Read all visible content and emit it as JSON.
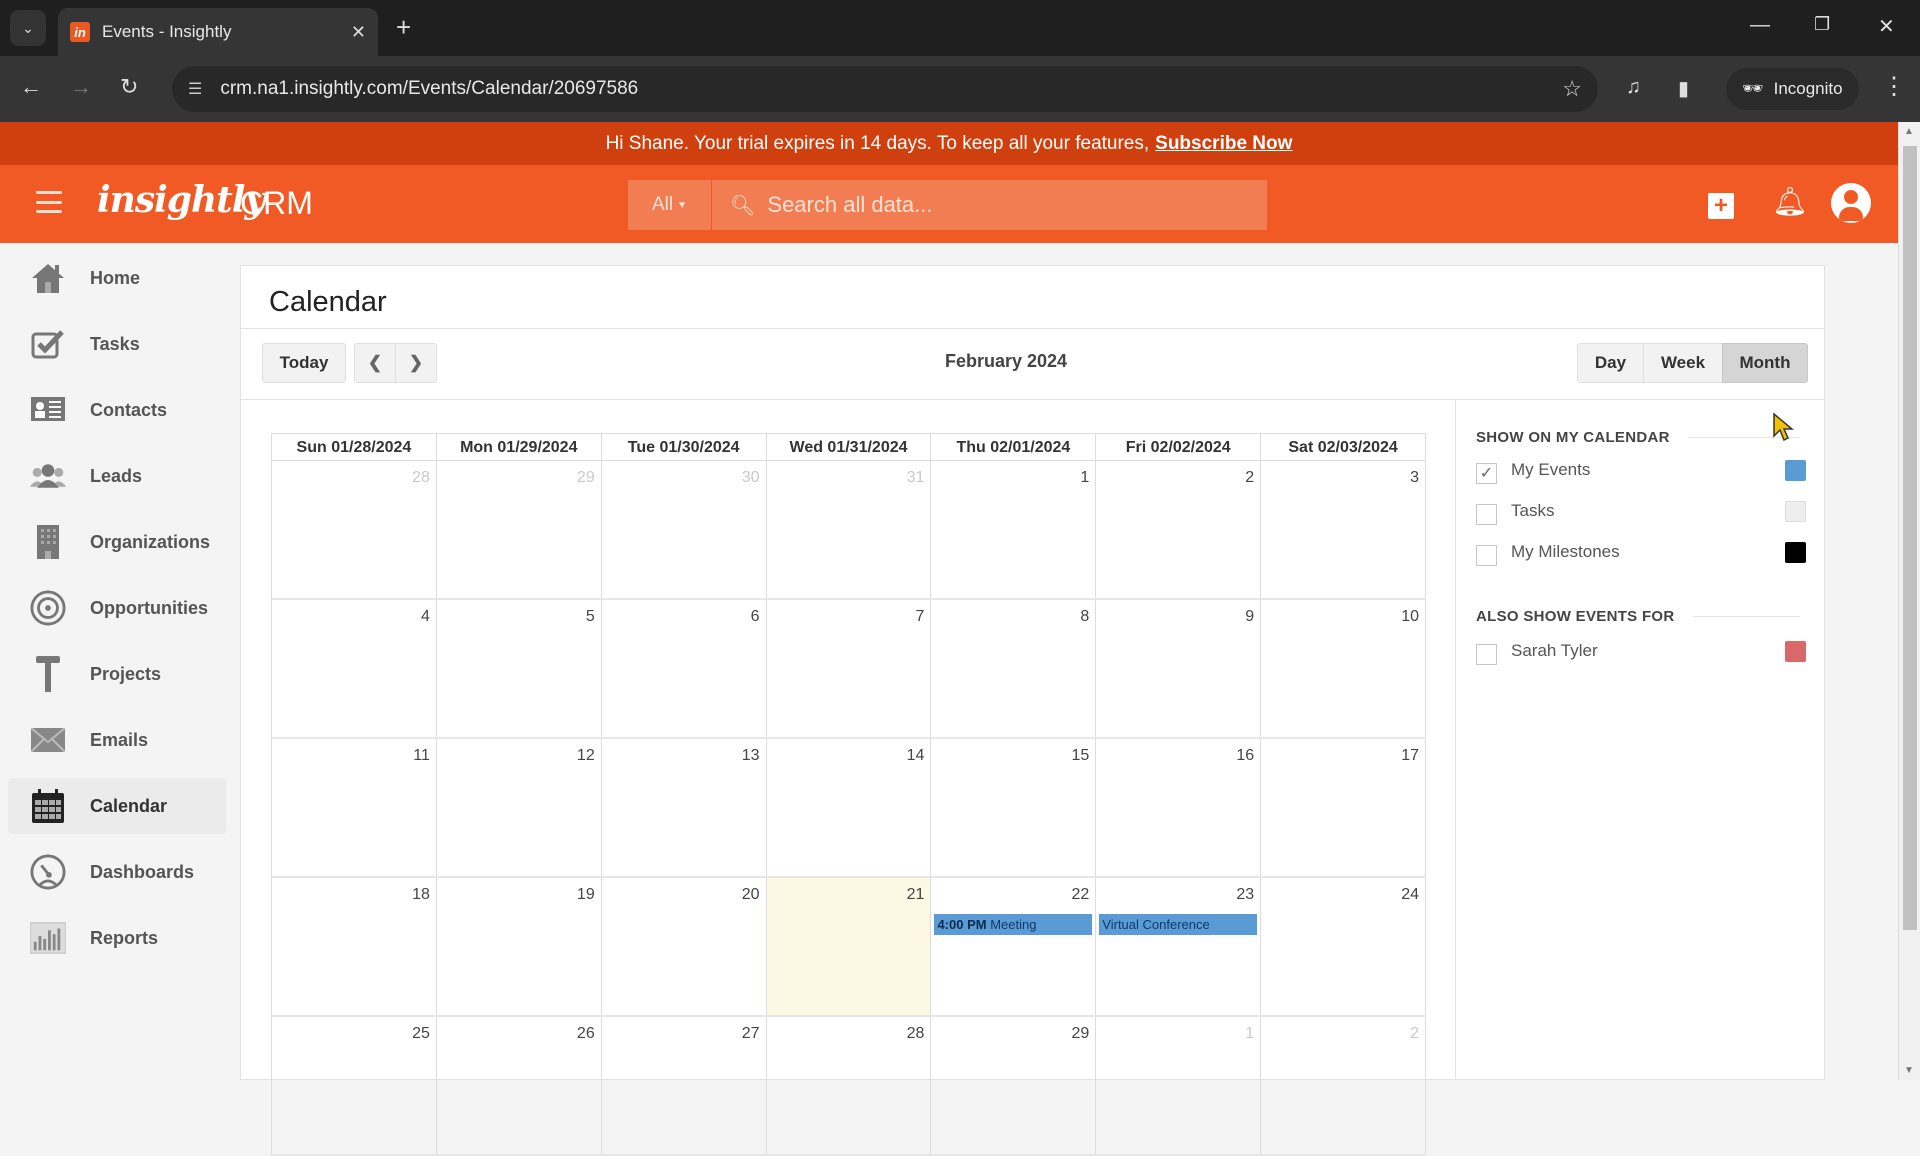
{
  "browser": {
    "tab_title": "Events - Insightly",
    "url": "crm.na1.insightly.com/Events/Calendar/20697586",
    "incognito_label": "Incognito"
  },
  "banner": {
    "message": "Hi Shane. Your trial expires in 14 days. To keep all your features,",
    "link": "Subscribe Now"
  },
  "header": {
    "logo": "insightly",
    "product": "CRM",
    "search_scope": "All",
    "search_placeholder": "Search all data..."
  },
  "sidebar": {
    "items": [
      {
        "label": "Home",
        "icon": "home-icon"
      },
      {
        "label": "Tasks",
        "icon": "tasks-icon"
      },
      {
        "label": "Contacts",
        "icon": "contacts-icon"
      },
      {
        "label": "Leads",
        "icon": "leads-icon"
      },
      {
        "label": "Organizations",
        "icon": "organizations-icon"
      },
      {
        "label": "Opportunities",
        "icon": "opportunities-icon"
      },
      {
        "label": "Projects",
        "icon": "projects-icon"
      },
      {
        "label": "Emails",
        "icon": "emails-icon"
      },
      {
        "label": "Calendar",
        "icon": "calendar-icon",
        "active": true
      },
      {
        "label": "Dashboards",
        "icon": "dashboards-icon"
      },
      {
        "label": "Reports",
        "icon": "reports-icon"
      }
    ]
  },
  "calendar": {
    "title": "Calendar",
    "today_label": "Today",
    "month_title": "February 2024",
    "views": {
      "day": "Day",
      "week": "Week",
      "month": "Month",
      "active": "Month"
    },
    "columns": [
      "Sun 01/28/2024",
      "Mon 01/29/2024",
      "Tue 01/30/2024",
      "Wed 01/31/2024",
      "Thu 02/01/2024",
      "Fri 02/02/2024",
      "Sat 02/03/2024"
    ],
    "weeks": [
      [
        {
          "n": "28",
          "other": true
        },
        {
          "n": "29",
          "other": true
        },
        {
          "n": "30",
          "other": true
        },
        {
          "n": "31",
          "other": true
        },
        {
          "n": "1"
        },
        {
          "n": "2"
        },
        {
          "n": "3"
        }
      ],
      [
        {
          "n": "4"
        },
        {
          "n": "5"
        },
        {
          "n": "6"
        },
        {
          "n": "7"
        },
        {
          "n": "8"
        },
        {
          "n": "9"
        },
        {
          "n": "10"
        }
      ],
      [
        {
          "n": "11"
        },
        {
          "n": "12"
        },
        {
          "n": "13"
        },
        {
          "n": "14"
        },
        {
          "n": "15"
        },
        {
          "n": "16"
        },
        {
          "n": "17"
        }
      ],
      [
        {
          "n": "18"
        },
        {
          "n": "19"
        },
        {
          "n": "20"
        },
        {
          "n": "21",
          "today": true
        },
        {
          "n": "22",
          "event": {
            "time": "4:00 PM",
            "title": "Meeting"
          }
        },
        {
          "n": "23",
          "event": {
            "time": "",
            "title": "Virtual Conference"
          }
        },
        {
          "n": "24"
        }
      ],
      [
        {
          "n": "25"
        },
        {
          "n": "26"
        },
        {
          "n": "27"
        },
        {
          "n": "28"
        },
        {
          "n": "29"
        },
        {
          "n": "1",
          "other": true
        },
        {
          "n": "2",
          "other": true
        }
      ]
    ]
  },
  "panel": {
    "show_heading": "SHOW ON MY CALENDAR",
    "show_items": [
      {
        "label": "My Events",
        "checked": true,
        "color": "#5b9bd5"
      },
      {
        "label": "Tasks",
        "checked": false,
        "color": "#eeeeee"
      },
      {
        "label": "My Milestones",
        "checked": false,
        "color": "#000000"
      }
    ],
    "also_heading": "ALSO SHOW EVENTS FOR",
    "also_items": [
      {
        "label": "Sarah Tyler",
        "checked": false,
        "color": "#d9686a"
      }
    ]
  },
  "colors": {
    "brand": "#f15a24",
    "banner": "#d0400e",
    "event": "#5b9bd5",
    "today": "#fcf8e3"
  }
}
